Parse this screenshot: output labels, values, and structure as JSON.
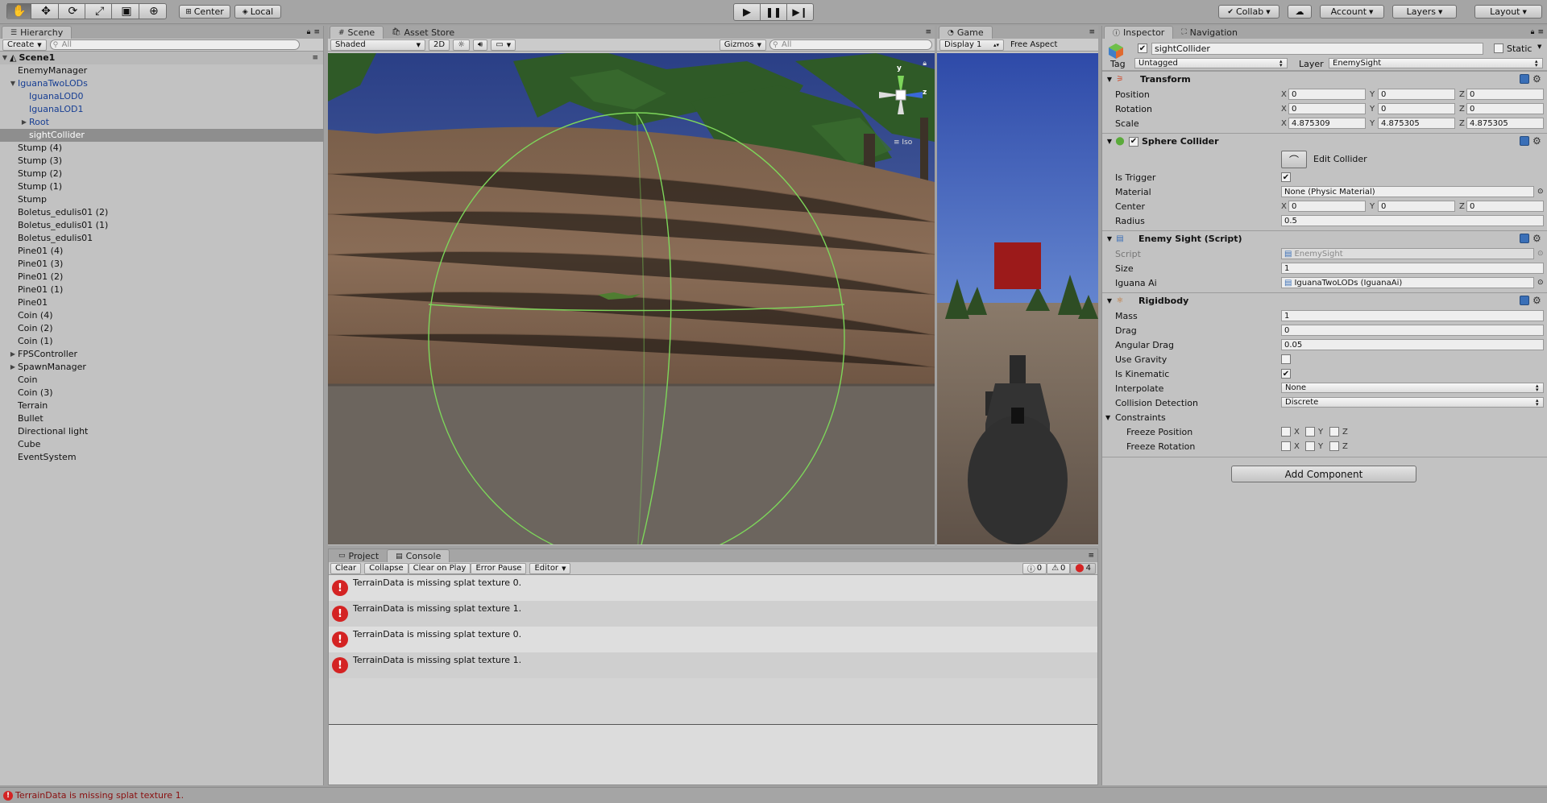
{
  "toolbar": {
    "tools": [
      "hand-tool-icon",
      "move-tool-icon",
      "rotate-tool-icon",
      "scale-tool-icon",
      "rect-tool-icon",
      "transform-tool-icon"
    ],
    "pivot": "Center",
    "space": "Local",
    "collab": "Collab",
    "account": "Account",
    "layers": "Layers",
    "layout": "Layout"
  },
  "hierarchy": {
    "tab": "Hierarchy",
    "create": "Create",
    "search_placeholder": "All",
    "scene_name": "Scene1",
    "items": [
      {
        "label": "EnemyManager",
        "indent": 1,
        "arrow": "",
        "style": ""
      },
      {
        "label": "IguanaTwoLODs",
        "indent": 1,
        "arrow": "down",
        "style": "blue"
      },
      {
        "label": "IguanaLOD0",
        "indent": 2,
        "arrow": "",
        "style": "blue"
      },
      {
        "label": "IguanaLOD1",
        "indent": 2,
        "arrow": "",
        "style": "blue"
      },
      {
        "label": "Root",
        "indent": 2,
        "arrow": "right",
        "style": "blue"
      },
      {
        "label": "sightCollider",
        "indent": 2,
        "arrow": "",
        "style": "sel"
      },
      {
        "label": "Stump (4)",
        "indent": 1,
        "arrow": "",
        "style": ""
      },
      {
        "label": "Stump (3)",
        "indent": 1,
        "arrow": "",
        "style": ""
      },
      {
        "label": "Stump (2)",
        "indent": 1,
        "arrow": "",
        "style": ""
      },
      {
        "label": "Stump (1)",
        "indent": 1,
        "arrow": "",
        "style": ""
      },
      {
        "label": "Stump",
        "indent": 1,
        "arrow": "",
        "style": ""
      },
      {
        "label": "Boletus_edulis01 (2)",
        "indent": 1,
        "arrow": "",
        "style": ""
      },
      {
        "label": "Boletus_edulis01 (1)",
        "indent": 1,
        "arrow": "",
        "style": ""
      },
      {
        "label": "Boletus_edulis01",
        "indent": 1,
        "arrow": "",
        "style": ""
      },
      {
        "label": "Pine01 (4)",
        "indent": 1,
        "arrow": "",
        "style": ""
      },
      {
        "label": "Pine01 (3)",
        "indent": 1,
        "arrow": "",
        "style": ""
      },
      {
        "label": "Pine01 (2)",
        "indent": 1,
        "arrow": "",
        "style": ""
      },
      {
        "label": "Pine01 (1)",
        "indent": 1,
        "arrow": "",
        "style": ""
      },
      {
        "label": "Pine01",
        "indent": 1,
        "arrow": "",
        "style": ""
      },
      {
        "label": "Coin (4)",
        "indent": 1,
        "arrow": "",
        "style": ""
      },
      {
        "label": "Coin (2)",
        "indent": 1,
        "arrow": "",
        "style": ""
      },
      {
        "label": "Coin (1)",
        "indent": 1,
        "arrow": "",
        "style": ""
      },
      {
        "label": "FPSController",
        "indent": 1,
        "arrow": "right",
        "style": ""
      },
      {
        "label": "SpawnManager",
        "indent": 1,
        "arrow": "right",
        "style": ""
      },
      {
        "label": "Coin",
        "indent": 1,
        "arrow": "",
        "style": ""
      },
      {
        "label": "Coin (3)",
        "indent": 1,
        "arrow": "",
        "style": ""
      },
      {
        "label": "Terrain",
        "indent": 1,
        "arrow": "",
        "style": ""
      },
      {
        "label": "Bullet",
        "indent": 1,
        "arrow": "",
        "style": ""
      },
      {
        "label": "Directional light",
        "indent": 1,
        "arrow": "",
        "style": ""
      },
      {
        "label": "Cube",
        "indent": 1,
        "arrow": "",
        "style": ""
      },
      {
        "label": "EventSystem",
        "indent": 1,
        "arrow": "",
        "style": ""
      }
    ]
  },
  "scene": {
    "tab": "Scene",
    "tab2": "Asset Store",
    "shading": "Shaded",
    "mode2d": "2D",
    "gizmos": "Gizmos",
    "search_placeholder": "All",
    "gizmo_y": "y",
    "gizmo_z": "z",
    "gizmo_iso": "Iso"
  },
  "game": {
    "tab": "Game",
    "display": "Display 1",
    "aspect": "Free Aspect"
  },
  "console": {
    "tab_project": "Project",
    "tab_console": "Console",
    "buttons": [
      "Clear",
      "Collapse",
      "Clear on Play",
      "Error Pause",
      "Editor"
    ],
    "info_count": "0",
    "warn_count": "0",
    "error_count": "4",
    "messages": [
      "TerrainData is missing splat texture 0.",
      "TerrainData is missing splat texture 1.",
      "TerrainData is missing splat texture 0.",
      "TerrainData is missing splat texture 1."
    ]
  },
  "inspector": {
    "tab": "Inspector",
    "tab2": "Navigation",
    "object_name": "sightCollider",
    "static_label": "Static",
    "tag_label": "Tag",
    "tag_value": "Untagged",
    "layer_label": "Layer",
    "layer_value": "EnemySight",
    "transform": {
      "title": "Transform",
      "position_label": "Position",
      "rotation_label": "Rotation",
      "scale_label": "Scale",
      "position": [
        "0",
        "0",
        "0"
      ],
      "rotation": [
        "0",
        "0",
        "0"
      ],
      "scale": [
        "4.875309",
        "4.875305",
        "4.875305"
      ]
    },
    "sphere": {
      "title": "Sphere Collider",
      "edit_collider": "Edit Collider",
      "is_trigger_label": "Is Trigger",
      "is_trigger": true,
      "material_label": "Material",
      "material": "None (Physic Material)",
      "center_label": "Center",
      "center": [
        "0",
        "0",
        "0"
      ],
      "radius_label": "Radius",
      "radius": "0.5"
    },
    "enemy_sight": {
      "title": "Enemy Sight (Script)",
      "script_label": "Script",
      "script": "EnemySight",
      "size_label": "Size",
      "size": "1",
      "iguana_label": "Iguana Ai",
      "iguana": "IguanaTwoLODs (IguanaAi)"
    },
    "rigidbody": {
      "title": "Rigidbody",
      "mass_label": "Mass",
      "mass": "1",
      "drag_label": "Drag",
      "drag": "0",
      "angular_drag_label": "Angular Drag",
      "angular_drag": "0.05",
      "use_gravity_label": "Use Gravity",
      "use_gravity": false,
      "is_kinematic_label": "Is Kinematic",
      "is_kinematic": true,
      "interpolate_label": "Interpolate",
      "interpolate": "None",
      "collision_label": "Collision Detection",
      "collision": "Discrete",
      "constraints_label": "Constraints",
      "freeze_pos_label": "Freeze Position",
      "freeze_rot_label": "Freeze Rotation"
    },
    "axis_x": "X",
    "axis_y": "Y",
    "axis_z": "Z",
    "add_component": "Add Component"
  },
  "status": {
    "message": "TerrainData is missing splat texture 1."
  },
  "colors": {
    "selection": "#8e8e8e",
    "prefab_blue": "#173e93",
    "error_red": "#d42323",
    "gizmo_green": "#7dd65a"
  }
}
